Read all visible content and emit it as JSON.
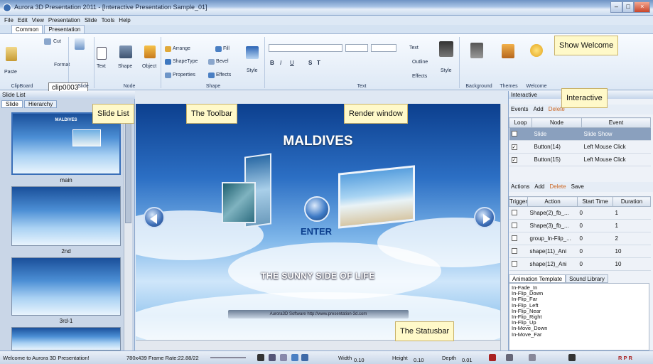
{
  "window": {
    "title": "Aurora 3D Presentation 2011 - [Interactive Presentation Sample_01]",
    "controls": [
      "–",
      "□",
      "×"
    ]
  },
  "menu": [
    "File",
    "Edit",
    "View",
    "Presentation",
    "Slide",
    "Tools",
    "Help"
  ],
  "ribbon_tabs": [
    "Common",
    "Presentation"
  ],
  "ribbon": {
    "clipboard": {
      "paste": "Paste",
      "cut": "Cut",
      "format": "Format",
      "group": "ClipBoard"
    },
    "tooltip": "clip0003",
    "slide": {
      "text": "Text",
      "group": "Slide"
    },
    "node": {
      "shape": "Shape",
      "object": "Object",
      "group": "Node"
    },
    "shape_group": {
      "arrange": "Arrange",
      "fill": "Fill",
      "shapetype": "ShapeType",
      "bevel": "Bevel",
      "properties": "Properties",
      "effects": "Effects",
      "style": "Style",
      "group": "Shape"
    },
    "text_group": {
      "text": "Text",
      "outline": "Outline",
      "effects": "Effects",
      "style": "Style",
      "group": "Text",
      "format_buttons": [
        "B",
        "I",
        "U",
        "S",
        "T"
      ]
    },
    "background": {
      "group": "Background"
    },
    "themes": {
      "group": "Themes"
    },
    "welcome": {
      "group": "Welcome"
    }
  },
  "slide_list": {
    "header": "Slide List",
    "tabs": [
      "Slide",
      "Hierarchy"
    ],
    "slides": [
      {
        "label": "main",
        "thumb_title": "MALDIVES"
      },
      {
        "label": "2nd"
      },
      {
        "label": "3rd-1"
      }
    ]
  },
  "render": {
    "title": "MALDIVES",
    "enter": "ENTER",
    "tagline": "THE SUNNY SIDE OF LIFE",
    "footer": "Aurora3D Software   http://www.presentation-3d.com"
  },
  "interactive": {
    "header": "Interactive",
    "events_toolbar": [
      "Events",
      "Add",
      "Delete"
    ],
    "events_columns": [
      "Loop",
      "Node",
      "Event"
    ],
    "events": [
      {
        "loop": false,
        "node": "Slide",
        "event": "Slide Show",
        "selected": true
      },
      {
        "loop": true,
        "node": "Button(14)",
        "event": "Left Mouse Click",
        "selected": false
      },
      {
        "loop": true,
        "node": "Button(15)",
        "event": "Left Mouse Click",
        "selected": false
      }
    ],
    "actions_toolbar": [
      "Actions",
      "Add",
      "Delete",
      "Save"
    ],
    "actions_columns": [
      "Trigger",
      "Action",
      "Start Time",
      "Duration"
    ],
    "actions": [
      {
        "action": "Shape(2)_fb_...",
        "start": "0",
        "duration": "1"
      },
      {
        "action": "Shape(3)_fb_...",
        "start": "0",
        "duration": "1"
      },
      {
        "action": "group_In-Flip_...",
        "start": "0",
        "duration": "2"
      },
      {
        "action": "shape(11)_Ani",
        "start": "0",
        "duration": "10"
      },
      {
        "action": "shape(12)_Ani",
        "start": "0",
        "duration": "10"
      }
    ],
    "anim_tabs": [
      "Animation Template",
      "Sound Library"
    ],
    "anim_templates": [
      "In-Fade_In",
      "In-Flip_Down",
      "In-Flip_Far",
      "In-Flip_Left",
      "In-Flip_Near",
      "In-Flip_Right",
      "In-Flip_Up",
      "In-Move_Down",
      "In-Move_Far"
    ]
  },
  "statusbar": {
    "welcome": "Welcome to Aurora 3D Presentation!",
    "frame": "780x439 Frame Rate:22.88/22",
    "width_label": "Width",
    "width_val": "0.10",
    "height_label": "Height",
    "height_val": "0.10",
    "depth_label": "Depth",
    "depth_val": "0.01",
    "rpr": "R P R"
  },
  "callouts": {
    "show_welcome": "Show Welcome",
    "slide_list": "Slide List",
    "toolbar": "The Toolbar",
    "render_window": "Render window",
    "interactive": "Interactive",
    "statusbar": "The Statusbar"
  },
  "colors": {
    "accent": "#2c6fc4",
    "callout_bg": "#fff9c9",
    "titlebar": "#a9c4e6"
  }
}
